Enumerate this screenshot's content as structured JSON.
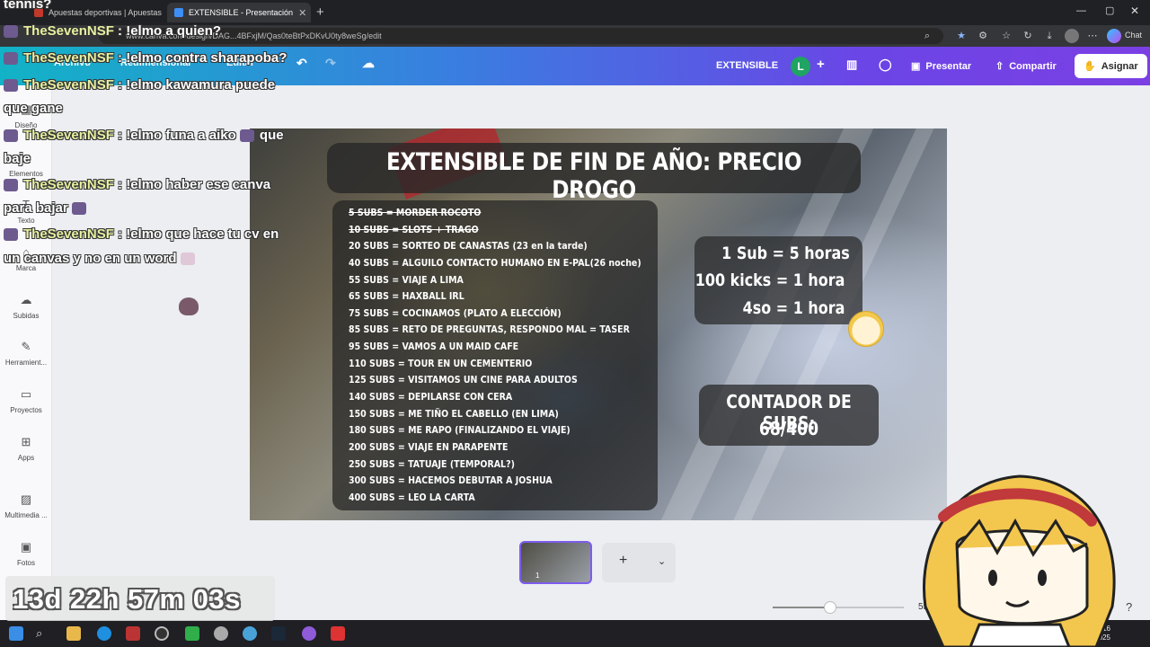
{
  "overlay_top_word": "tennis?",
  "browser": {
    "tabs": [
      {
        "title": "Apuestas deportivas | Apuestas on",
        "active": false
      },
      {
        "title": "EXTENSIBLE - Presentación",
        "active": true
      }
    ],
    "new_tab": "+",
    "url": "www.canva.com/design/DAG...4BFxjM/Qas0teBtPxDKvU0ty8weSg/edit"
  },
  "header": {
    "menu": [
      "Archivo",
      "Redimensionar",
      "Editar"
    ],
    "doc_title": "EXTENSIBLE",
    "avatar_letter": "L",
    "present_label": "Presentar",
    "share_label": "Compartir",
    "assign_label": "Asignar"
  },
  "sidebar": {
    "items": [
      {
        "label": "Diseño",
        "icon": "layout-icon"
      },
      {
        "label": "Elementos",
        "icon": "shapes-icon"
      },
      {
        "label": "Texto",
        "icon": "text-icon"
      },
      {
        "label": "Marca",
        "icon": "brand-icon"
      },
      {
        "label": "Subidas",
        "icon": "upload-cloud-icon"
      },
      {
        "label": "Herramient...",
        "icon": "pen-icon"
      },
      {
        "label": "Proyectos",
        "icon": "folder-icon"
      },
      {
        "label": "Apps",
        "icon": "apps-grid-icon"
      },
      {
        "label": "Multimedia ...",
        "icon": "media-icon"
      },
      {
        "label": "Fotos",
        "icon": "photo-icon"
      }
    ]
  },
  "slide": {
    "title": "EXTENSIBLE DE FIN DE AÑO: PRECIO DROGO",
    "goals": [
      {
        "text": "5 SUBS = MORDER ROCOTO",
        "done": true
      },
      {
        "text": "10 SUBS = SLOTS + TRAGO",
        "done": true
      },
      {
        "text": "20 SUBS = SORTEO DE CANASTAS (23 en la tarde)",
        "done": false
      },
      {
        "text": "40 SUBS = ALGUILO CONTACTO HUMANO EN E-PAL(26 noche)",
        "done": false
      },
      {
        "text": "55 SUBS = VIAJE A LIMA",
        "done": false
      },
      {
        "text": "65 SUBS = HAXBALL IRL",
        "done": false
      },
      {
        "text": "75 SUBS = COCINAMOS (PLATO A ELECCIÓN)",
        "done": false
      },
      {
        "text": "85 SUBS = RETO DE PREGUNTAS, RESPONDO MAL = TASER",
        "done": false
      },
      {
        "text": "95 SUBS = VAMOS A UN MAID CAFE",
        "done": false
      },
      {
        "text": "110 SUBS = TOUR EN UN CEMENTERIO",
        "done": false
      },
      {
        "text": "125 SUBS = VISITAMOS UN CINE PARA ADULTOS",
        "done": false
      },
      {
        "text": "140 SUBS = DEPILARSE CON CERA",
        "done": false
      },
      {
        "text": "150 SUBS = ME TIÑO EL CABELLO (EN LIMA)",
        "done": false
      },
      {
        "text": "180 SUBS = ME RAPO (FINALIZANDO EL VIAJE)",
        "done": false
      },
      {
        "text": "200 SUBS = VIAJE EN PARAPENTE",
        "done": false
      },
      {
        "text": "250 SUBS = TATUAJE (TEMPORAL?)",
        "done": false
      },
      {
        "text": "300 SUBS = HACEMOS DEBUTAR A JOSHUA",
        "done": false
      },
      {
        "text": "400 SUBS = LEO LA CARTA",
        "done": false
      }
    ],
    "rates": [
      "1 Sub = 5 horas",
      "100 kicks = 1 hora",
      "4so = 1 hora"
    ],
    "counter_label": "CONTADOR DE SUBS:",
    "counter_value": "68/400"
  },
  "pages": {
    "page_number": "1",
    "add_label": "+",
    "expand_icon": "chevron-down-icon"
  },
  "zoom": {
    "label": "55 %",
    "value_fraction": 0.44
  },
  "taskbar": {
    "time": "02:16",
    "date": "23/12/2025"
  },
  "chat": [
    {
      "user": "TheSevenNSF",
      "text": ": !elmo a quien?",
      "wrap": ""
    },
    {
      "user": "TheSevenNSF",
      "text": ": !elmo contra sharapoba?",
      "wrap": ""
    },
    {
      "user": "TheSevenNSF",
      "text": ": !elmo kawamura puede",
      "wrap": "que gane"
    },
    {
      "user": "TheSevenNSF",
      "text": ": !elmo funa a aiko",
      "wrap": "baje",
      "after": "que"
    },
    {
      "user": "TheSevenNSF",
      "text": ": !elmo haber ese canva",
      "wrap": "para bajar"
    },
    {
      "user": "TheSevenNSF",
      "text": ": !elmo que hace tu cv en",
      "wrap": "un canvas y no en un word"
    }
  ],
  "timer": "13d 22h 57m 03s",
  "chrome_label": "Chat"
}
